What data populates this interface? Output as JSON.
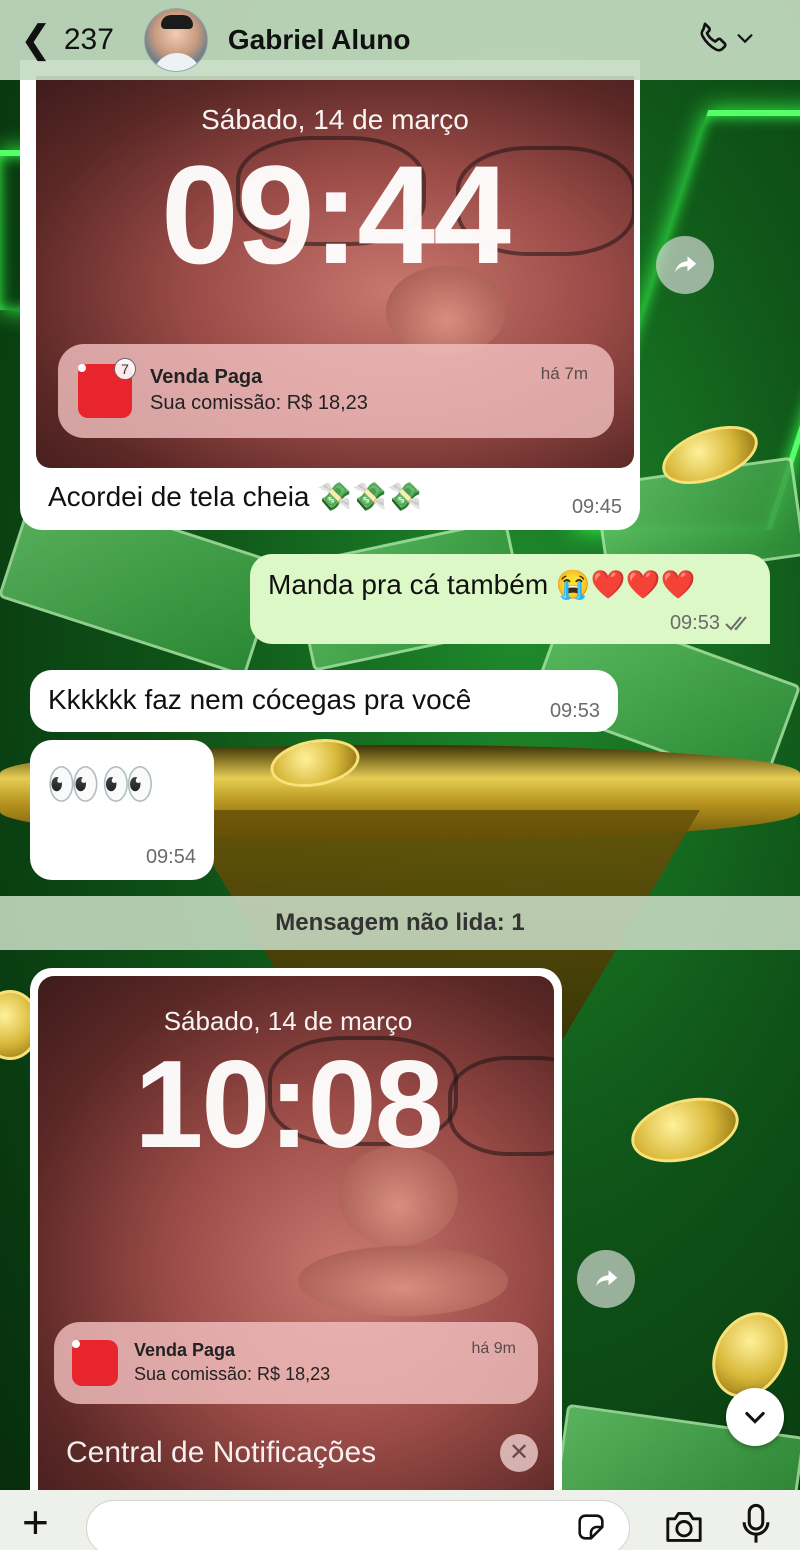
{
  "header": {
    "back_count": "237",
    "contact_name": "Gabriel Aluno"
  },
  "messages": [
    {
      "lock": {
        "date": "Sábado, 14 de março",
        "time": "09:44",
        "notification": {
          "title": "Venda Paga",
          "body": "Sua comissão: R$ 18,23",
          "time": "há 7m",
          "badge": "7"
        }
      },
      "caption": "Acordei de tela cheia 💸💸💸",
      "time": "09:45"
    },
    {
      "text": "Manda pra cá também 😭❤️❤️❤️",
      "time": "09:53"
    },
    {
      "text": "Kkkkkk faz nem cócegas pra você",
      "time": "09:53"
    },
    {
      "text": "👀👀",
      "time": "09:54"
    },
    {
      "lock": {
        "date": "Sábado, 14 de março",
        "time": "10:08",
        "notification": {
          "title": "Venda Paga",
          "body": "Sua comissão: R$ 18,23",
          "time": "há 9m"
        },
        "center_label": "Central de Notificações"
      }
    }
  ],
  "unread_banner": "Mensagem não lida: 1",
  "input": {
    "placeholder": ""
  },
  "colors": {
    "incoming": "#ffffff",
    "outgoing": "#dbf8c6",
    "header": "#c4dbc1",
    "notif_icon": "#e8252c"
  }
}
